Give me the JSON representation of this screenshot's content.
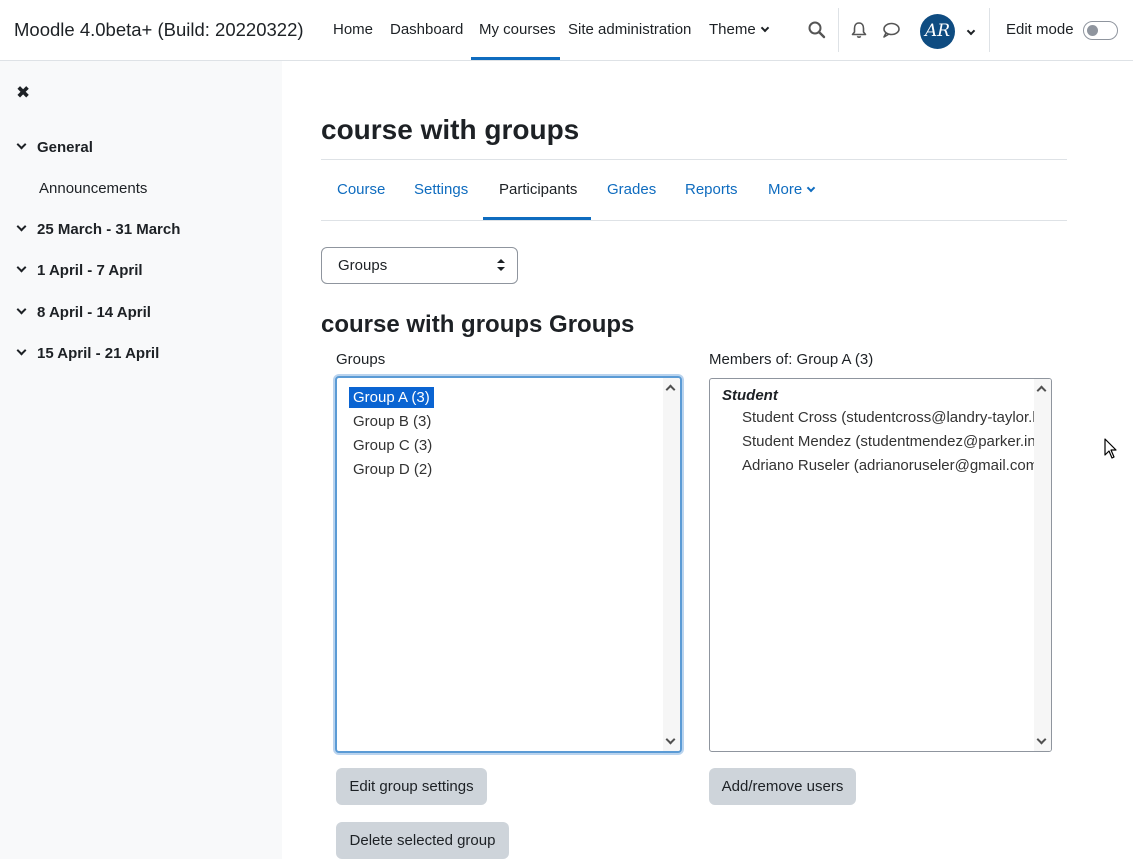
{
  "navbar": {
    "brand": "Moodle 4.0beta+ (Build: 20220322)",
    "items": [
      {
        "label": "Home"
      },
      {
        "label": "Dashboard"
      },
      {
        "label": "My courses"
      },
      {
        "label": "Site administration"
      },
      {
        "label": "Theme"
      }
    ],
    "avatar_initials": "AR",
    "edit_mode_label": "Edit mode"
  },
  "drawer": {
    "sections": [
      {
        "label": "General"
      },
      {
        "label": "25 March - 31 March"
      },
      {
        "label": "1 April - 7 April"
      },
      {
        "label": "8 April - 14 April"
      },
      {
        "label": "15 April - 21 April"
      }
    ],
    "general_items": [
      "Announcements"
    ]
  },
  "main": {
    "title": "course with groups",
    "tabs": [
      {
        "label": "Course"
      },
      {
        "label": "Settings"
      },
      {
        "label": "Participants"
      },
      {
        "label": "Grades"
      },
      {
        "label": "Reports"
      },
      {
        "label": "More"
      }
    ],
    "select_value": "Groups",
    "heading": "course with groups Groups",
    "groups_label": "Groups",
    "members_label": "Members of: Group A (3)",
    "groups": [
      "Group A (3)",
      "Group B (3)",
      "Group C (3)",
      "Group D (2)"
    ],
    "members_role": "Student",
    "members": [
      "Student Cross (studentcross@landry-taylor.b",
      "Student Mendez (studentmendez@parker.inf",
      "Adriano Ruseler (adrianoruseler@gmail.com"
    ],
    "buttons": {
      "edit_group_settings": "Edit group settings",
      "delete_selected_group": "Delete selected group",
      "add_remove_users": "Add/remove users"
    }
  },
  "colors": {
    "accent": "#0f6cbf",
    "selected_option": "#0a64d2",
    "button_bg": "#ced4da",
    "drawer_bg": "#f8f9fa"
  }
}
